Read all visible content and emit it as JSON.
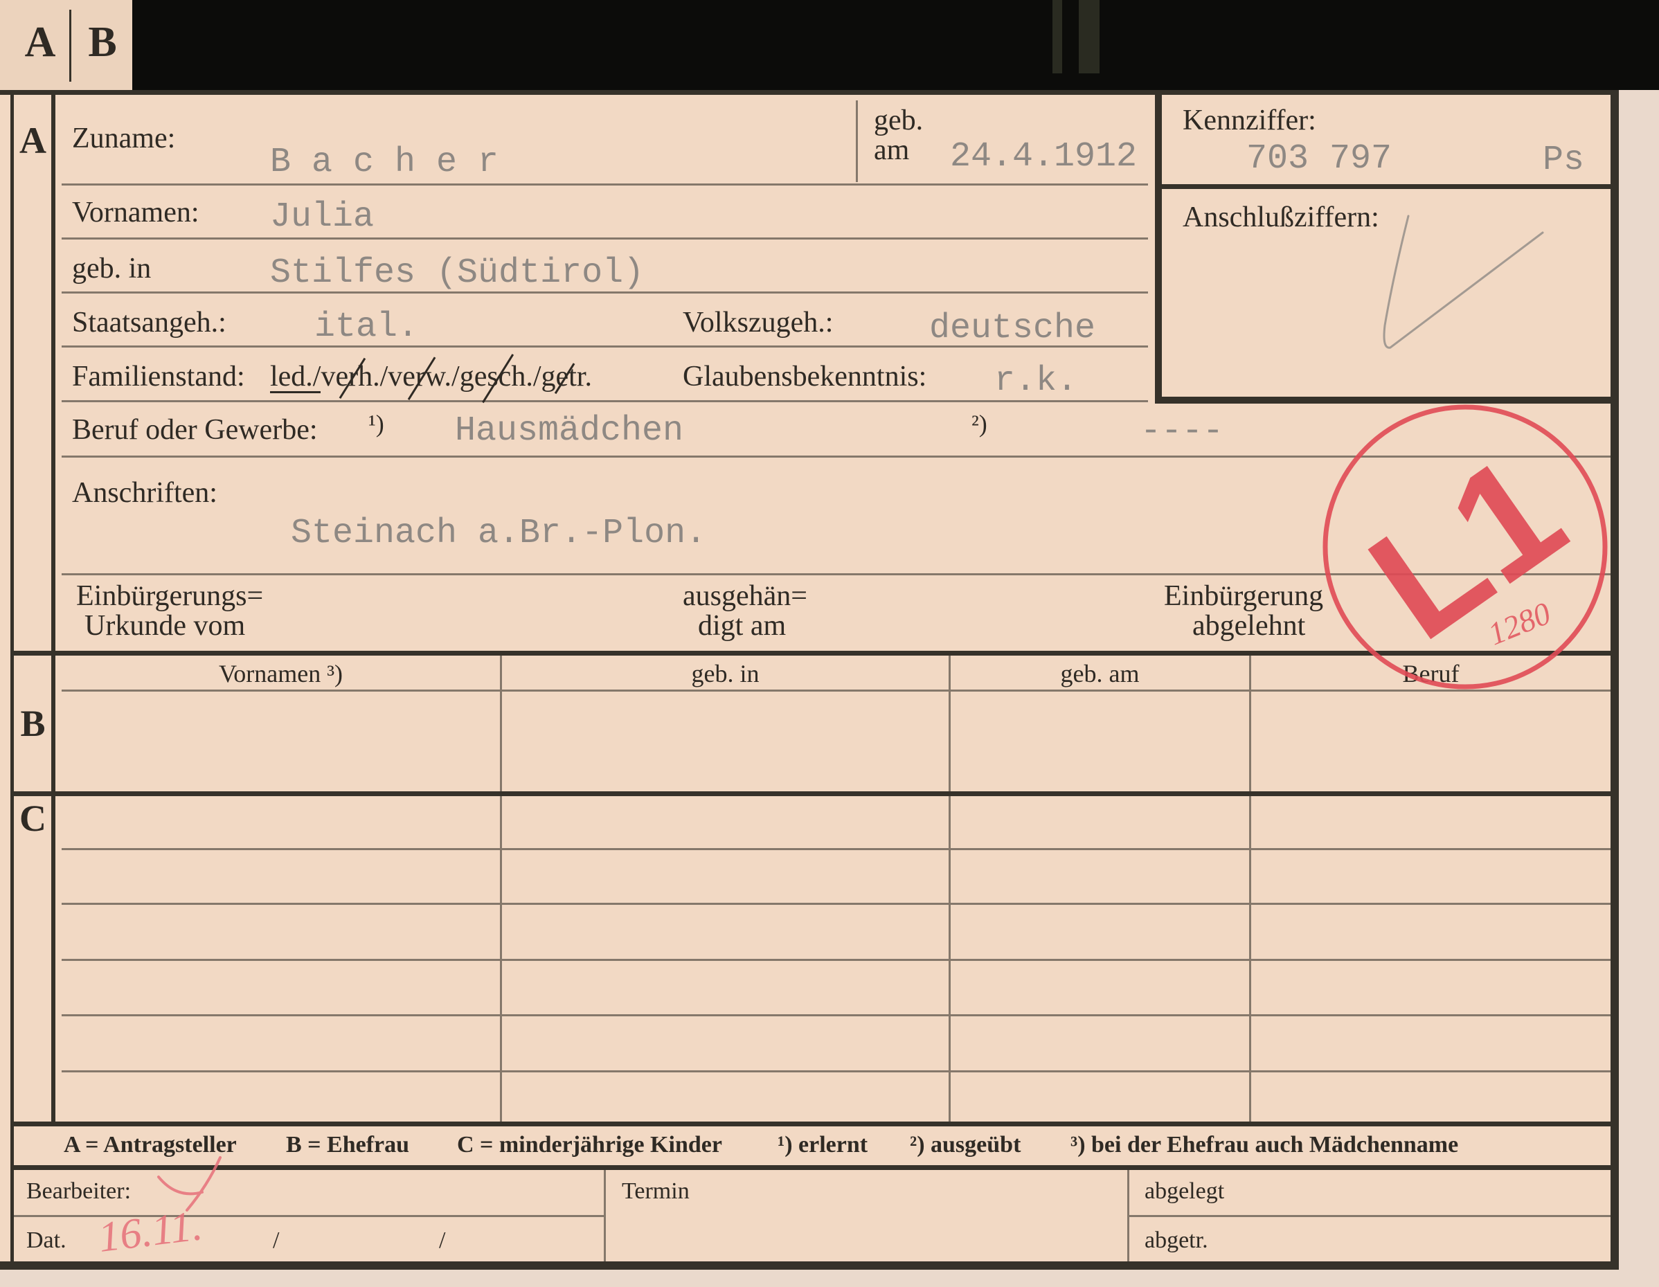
{
  "tab": {
    "letter_a": "A",
    "letter_b": "B"
  },
  "section_letters": {
    "a": "A",
    "b": "B",
    "c": "C"
  },
  "section_a": {
    "zuname": {
      "label": "Zuname:",
      "value": "B a c h e r"
    },
    "geburtsdatum": {
      "label_line1": "geb.",
      "label_line2": "am",
      "value": "24.4.1912"
    },
    "vornamen": {
      "label": "Vornamen:",
      "value": "Julia"
    },
    "geburtsort": {
      "label": "geb. in",
      "value": "Stilfes (Südtirol)"
    },
    "staatsangehoerigkeit": {
      "label": "Staatsangeh.:",
      "value": "ital."
    },
    "volkszugehoerigkeit": {
      "label": "Volkszugeh.:",
      "value": "deutsche"
    },
    "familienstand": {
      "label": "Familienstand:",
      "options": [
        {
          "text": "led./",
          "crossed_out": false,
          "underlined": true
        },
        {
          "text": "verh./",
          "crossed_out": true,
          "underlined": false
        },
        {
          "text": "verw./",
          "crossed_out": true,
          "underlined": false
        },
        {
          "text": "gesch./",
          "crossed_out": true,
          "underlined": false
        },
        {
          "text": "getr.",
          "crossed_out": true,
          "underlined": false
        }
      ]
    },
    "glaubensbekenntnis": {
      "label": "Glaubensbekenntnis:",
      "value": "r.k."
    },
    "beruf": {
      "label": "Beruf oder Gewerbe:",
      "note_1": "¹)",
      "value_1": "Hausmädchen",
      "note_2": "²)",
      "value_2": "----"
    },
    "anschriften": {
      "label": "Anschriften:",
      "value": "Steinach a.Br.-Plon."
    },
    "einbuergerung": {
      "urkunde_line1": "Einbürgerungs=",
      "urkunde_line2": "Urkunde vom",
      "ausgehaendigt_line1": "ausgehän=",
      "ausgehaendigt_line2": "digt am",
      "abgelehnt_line1": "Einbürgerung",
      "abgelehnt_line2": "abgelehnt"
    }
  },
  "kennziffer": {
    "label": "Kennziffer:",
    "value": "703 797",
    "suffix": "Ps",
    "anschluss_label": "Anschlußziffern:"
  },
  "stamp": {
    "text": "L1",
    "handwritten_note": "1280"
  },
  "table": {
    "columns": [
      "Vornamen ³)",
      "geb. in",
      "geb. am",
      "Beruf"
    ]
  },
  "legend": [
    "A = Antragsteller",
    "B = Ehefrau",
    "C = minderjährige Kinder",
    "¹) erlernt",
    "²) ausgeübt",
    "³) bei der Ehefrau auch Mädchenname"
  ],
  "footer": {
    "bearbeiter": "Bearbeiter:",
    "dat": "Dat.",
    "slash_1": "/",
    "slash_2": "/",
    "dat_handwritten": "16.11.",
    "termin": "Termin",
    "abgelegt": "abgelegt",
    "abgetragen": "abgetr."
  },
  "colors": {
    "paper": "#f2d9c4",
    "ink": "#2f2a24",
    "typewriter": "#8e8883",
    "rule": "#36322a",
    "rule_thin": "#85786b",
    "stamp": "#e04a55",
    "handwriting": "#e6707a",
    "pencil": "#a39a92",
    "scan_background": "#0c0c0a",
    "margin_strip": "#ead9cc"
  }
}
